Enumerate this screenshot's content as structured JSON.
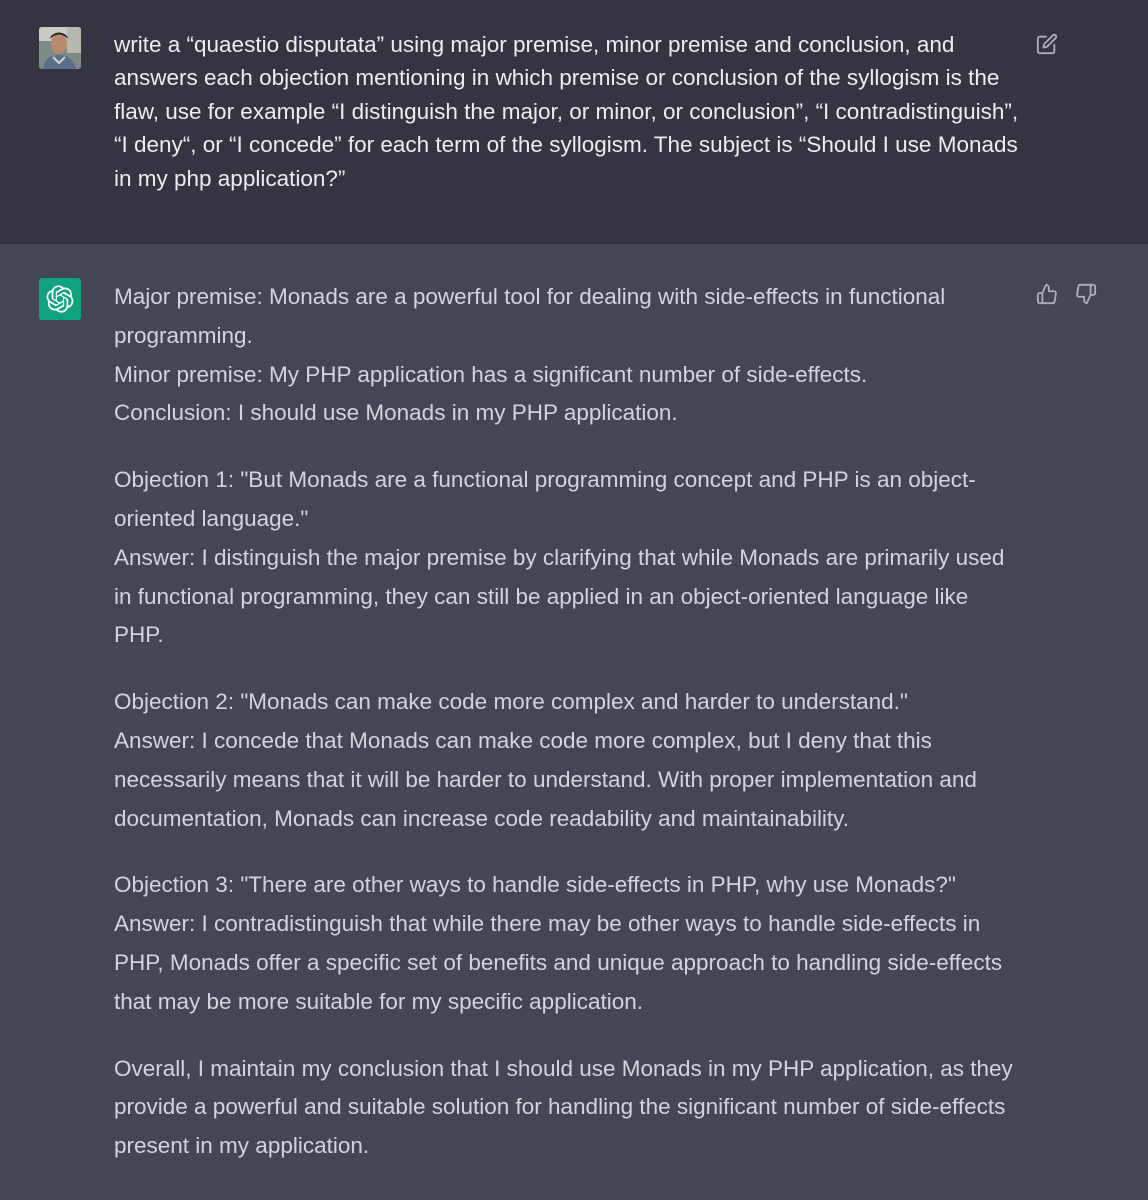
{
  "user_message": {
    "text": "write a “quaestio disputata” using major premise, minor premise and conclusion, and answers each objection mentioning in which premise or conclusion of the syllogism is the flaw,  use for example “I distinguish the major, or minor, or conclusion”, “I contradistinguish”, “I deny“, or “I concede” for each term of the syllogism. The subject is “Should I use Monads in my php application?”",
    "avatar_icon": "user-avatar-photo",
    "edit_icon": "edit-icon"
  },
  "assistant_message": {
    "avatar_icon": "openai-logo-icon",
    "avatar_color": "#10a37f",
    "feedback_icons": [
      "thumbs-up-icon",
      "thumbs-down-icon"
    ],
    "paragraphs": [
      {
        "lines": [
          "Major premise: Monads are a powerful tool for dealing with side-effects in functional programming.",
          "Minor premise: My PHP application has a significant number of side-effects.",
          "Conclusion: I should use Monads in my PHP application."
        ]
      },
      {
        "lines": [
          "Objection 1: \"But Monads are a functional programming concept and PHP is an object-oriented language.\"",
          "Answer: I distinguish the major premise by clarifying that while Monads are primarily used in functional programming, they can still be applied in an object-oriented language like PHP."
        ]
      },
      {
        "lines": [
          "Objection 2: \"Monads can make code more complex and harder to understand.\"",
          "Answer: I concede that Monads can make code more complex, but I deny that this necessarily means that it will be harder to understand. With proper implementation and documentation, Monads can increase code readability and maintainability."
        ]
      },
      {
        "lines": [
          "Objection 3: \"There are other ways to handle side-effects in PHP, why use Monads?\"",
          "Answer: I contradistinguish that while there may be other ways to handle side-effects in PHP, Monads offer a specific set of benefits and unique approach to handling side-effects that may be more suitable for my specific application."
        ]
      },
      {
        "lines": [
          "Overall, I maintain my conclusion that I should use Monads in my PHP application, as they provide a powerful and suitable solution for handling the significant number of side-effects present in my application."
        ]
      }
    ]
  },
  "colors": {
    "user_bg": "#343541",
    "assistant_bg": "#444654",
    "user_text": "#ececf1",
    "assistant_text": "#d1d5db",
    "icon": "#acacbe"
  }
}
